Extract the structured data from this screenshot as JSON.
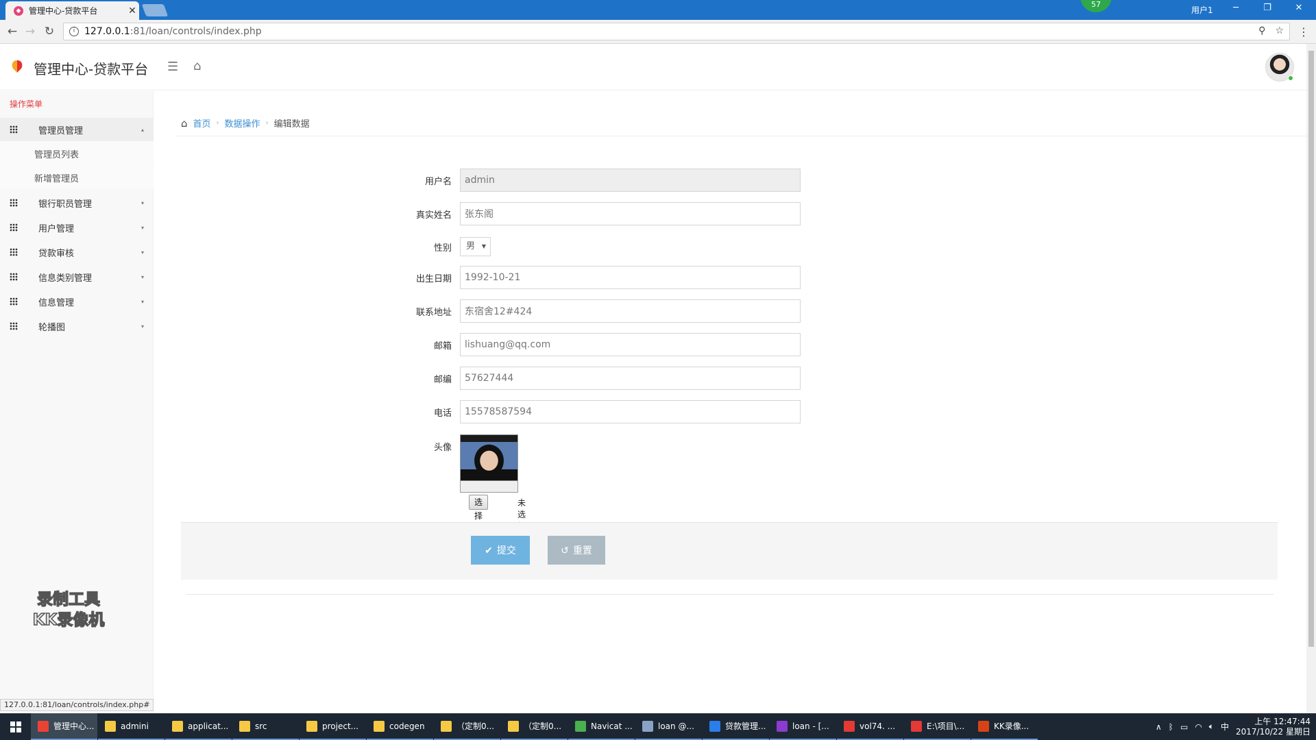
{
  "browser": {
    "tab_title": "管理中心-贷款平台",
    "tab_close": "✕",
    "notif_count": "57",
    "user_label": "用户1",
    "url_host": "127.0.0.1",
    "url_path": ":81/loan/controls/index.php",
    "status_url": "127.0.0.1:81/loan/controls/index.php#"
  },
  "header": {
    "title": "管理中心-贷款平台"
  },
  "sidebar": {
    "heading": "操作菜单",
    "items": [
      {
        "label": "管理员管理"
      },
      {
        "label": "银行职员管理"
      },
      {
        "label": "用户管理"
      },
      {
        "label": "贷款审核"
      },
      {
        "label": "信息类别管理"
      },
      {
        "label": "信息管理"
      },
      {
        "label": "轮播图"
      }
    ],
    "subitems": [
      {
        "label": "管理员列表"
      },
      {
        "label": "新增管理员"
      }
    ],
    "watermark_line1": "录制工具",
    "watermark_line2": "KK录像机"
  },
  "breadcrumb": {
    "home": "首页",
    "section": "数据操作",
    "current": "编辑数据"
  },
  "form": {
    "username_label": "用户名",
    "username_value": "admin",
    "realname_label": "真实姓名",
    "realname_value": "张东阁",
    "gender_label": "性别",
    "gender_value": "男",
    "birth_label": "出生日期",
    "birth_value": "1992-10-21",
    "address_label": "联系地址",
    "address_value": "东宿舍12#424",
    "email_label": "邮箱",
    "email_value": "lishuang@qq.com",
    "zip_label": "邮编",
    "zip_value": "57627444",
    "phone_label": "电话",
    "phone_value": "15578587594",
    "avatar_label": "头像",
    "file_button": "选择文件",
    "file_status": "未选择任何文件",
    "submit_label": "提交",
    "reset_label": "重置"
  },
  "taskbar": {
    "tasks": [
      {
        "label": "管理中心...",
        "color": "#ea4335"
      },
      {
        "label": "admini",
        "color": "#f6c944"
      },
      {
        "label": "applicat...",
        "color": "#f6c944"
      },
      {
        "label": "src",
        "color": "#f6c944"
      },
      {
        "label": "project...",
        "color": "#f6c944"
      },
      {
        "label": "codegen",
        "color": "#f6c944"
      },
      {
        "label": "（定制0...",
        "color": "#f6c944"
      },
      {
        "label": "（定制0...",
        "color": "#f6c944"
      },
      {
        "label": "Navicat ...",
        "color": "#4caf50"
      },
      {
        "label": "loan @...",
        "color": "#8aa3c4"
      },
      {
        "label": "贷款管理...",
        "color": "#2b7de9"
      },
      {
        "label": "loan - [...",
        "color": "#8c3bd0"
      },
      {
        "label": "vol74. ...",
        "color": "#e53935"
      },
      {
        "label": "E:\\项目\\...",
        "color": "#e53935"
      },
      {
        "label": "KK录像...",
        "color": "#d84315"
      }
    ],
    "ime": "中",
    "time": "上午 12:47:44",
    "date": "2017/10/22 星期日"
  },
  "colors": {
    "accent": "#6fb3e0",
    "link": "#3d8fd1",
    "menu_heading": "#e4393c"
  }
}
